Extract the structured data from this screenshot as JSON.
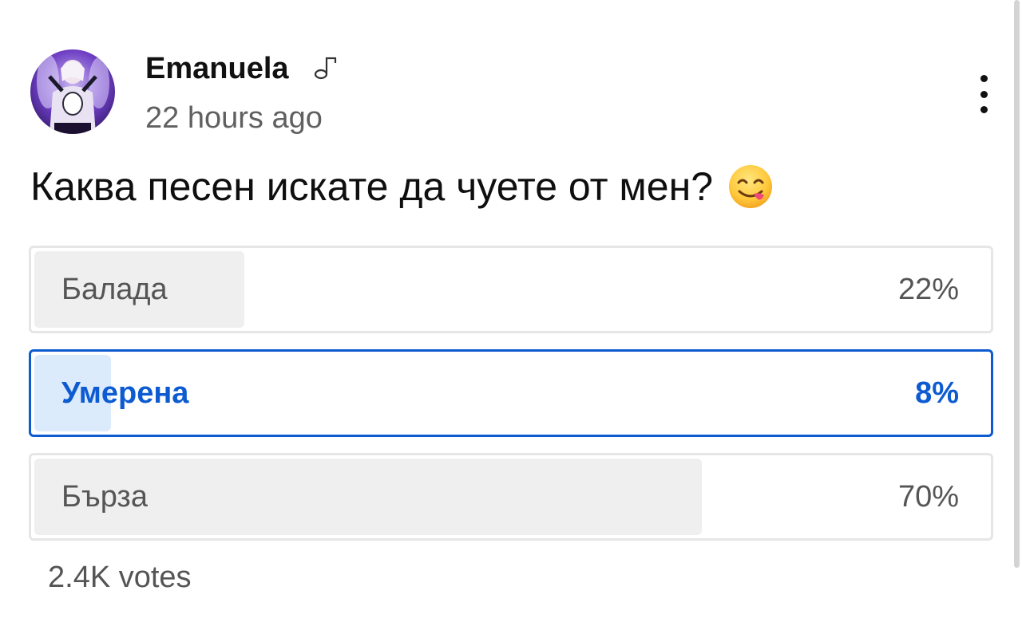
{
  "post": {
    "author": "Emanuela",
    "author_badge_icon": "music-note-icon",
    "timestamp": "22 hours ago",
    "menu_icon": "more-vertical-icon"
  },
  "poll": {
    "question": "Каква песен искате да чуете от мен?",
    "question_emoji": "yum-face-emoji",
    "options": [
      {
        "label": "Балада",
        "percent_text": "22%",
        "fraction": 0.22,
        "selected": false
      },
      {
        "label": "Умерена",
        "percent_text": "8%",
        "fraction": 0.08,
        "selected": true
      },
      {
        "label": "Бърза",
        "percent_text": "70%",
        "fraction": 0.7,
        "selected": false
      }
    ],
    "votes": "2.4K votes"
  },
  "colors": {
    "selected_accent": "#0d5bd1",
    "selected_fill": "#dcebfb",
    "option_fill": "#efefef",
    "option_border": "#e6e6e6",
    "muted_text": "#555555",
    "timestamp_text": "#606060"
  }
}
